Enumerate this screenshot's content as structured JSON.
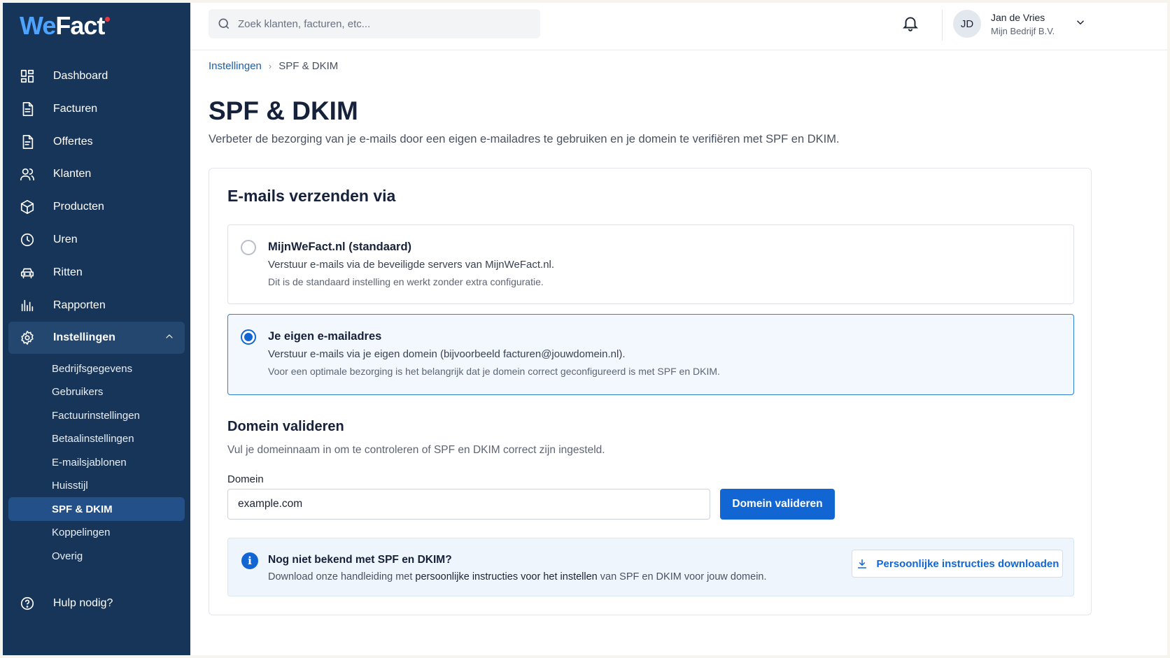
{
  "brand": {
    "logo_we": "We",
    "logo_fact": "Fact"
  },
  "search": {
    "placeholder": "Zoek klanten, facturen, etc..."
  },
  "user": {
    "initials": "JD",
    "name": "Jan de Vries",
    "company": "Mijn Bedrijf B.V."
  },
  "sidebar": {
    "items": [
      {
        "label": "Dashboard",
        "icon": "dashboard-icon"
      },
      {
        "label": "Facturen",
        "icon": "invoice-icon"
      },
      {
        "label": "Offertes",
        "icon": "quote-icon"
      },
      {
        "label": "Klanten",
        "icon": "users-icon"
      },
      {
        "label": "Producten",
        "icon": "box-icon"
      },
      {
        "label": "Uren",
        "icon": "clock-icon"
      },
      {
        "label": "Ritten",
        "icon": "car-icon"
      },
      {
        "label": "Rapporten",
        "icon": "chart-icon"
      },
      {
        "label": "Instellingen",
        "icon": "gear-icon"
      }
    ],
    "subitems": [
      {
        "label": "Bedrijfsgegevens"
      },
      {
        "label": "Gebruikers"
      },
      {
        "label": "Factuurinstellingen"
      },
      {
        "label": "Betaalinstellingen"
      },
      {
        "label": "E-mailsjablonen"
      },
      {
        "label": "Huisstijl"
      },
      {
        "label": "SPF & DKIM"
      },
      {
        "label": "Koppelingen"
      },
      {
        "label": "Overig"
      }
    ],
    "help": "Hulp nodig?"
  },
  "breadcrumb": {
    "parent": "Instellingen",
    "current": "SPF & DKIM"
  },
  "page": {
    "title": "SPF & DKIM",
    "description": "Verbeter de bezorging van je e-mails door een eigen e-mailadres te gebruiken en je domein te verifiëren met SPF en DKIM."
  },
  "card": {
    "title": "E-mails verzenden via",
    "options": [
      {
        "title": "MijnWeFact.nl (standaard)",
        "line1": "Verstuur e-mails via de beveiligde servers van MijnWeFact.nl.",
        "line2": "Dit is de standaard instelling en werkt zonder extra configuratie.",
        "selected": false
      },
      {
        "title": "Je eigen e-mailadres",
        "line1": "Verstuur e-mails via je eigen domein (bijvoorbeeld facturen@jouwdomein.nl).",
        "line2": "Voor een optimale bezorging is het belangrijk dat je domein correct geconfigureerd is met SPF en DKIM.",
        "selected": true
      }
    ]
  },
  "validate": {
    "title": "Domein valideren",
    "description": "Vul je domeinnaam in om te controleren of SPF en DKIM correct zijn ingesteld.",
    "field_label": "Domein",
    "field_value": "example.com",
    "button": "Domein valideren"
  },
  "info": {
    "title": "Nog niet bekend met SPF en DKIM?",
    "text_a": "Download onze handleiding met ",
    "text_b": "persoonlijke instructies voor het instellen",
    "text_c": " van SPF en DKIM voor jouw domein.",
    "button": "Persoonlijke instructies downloaden"
  },
  "colors": {
    "sidebar": "#173559",
    "accent": "#1266d4",
    "logo_we": "#4ea3ff"
  }
}
